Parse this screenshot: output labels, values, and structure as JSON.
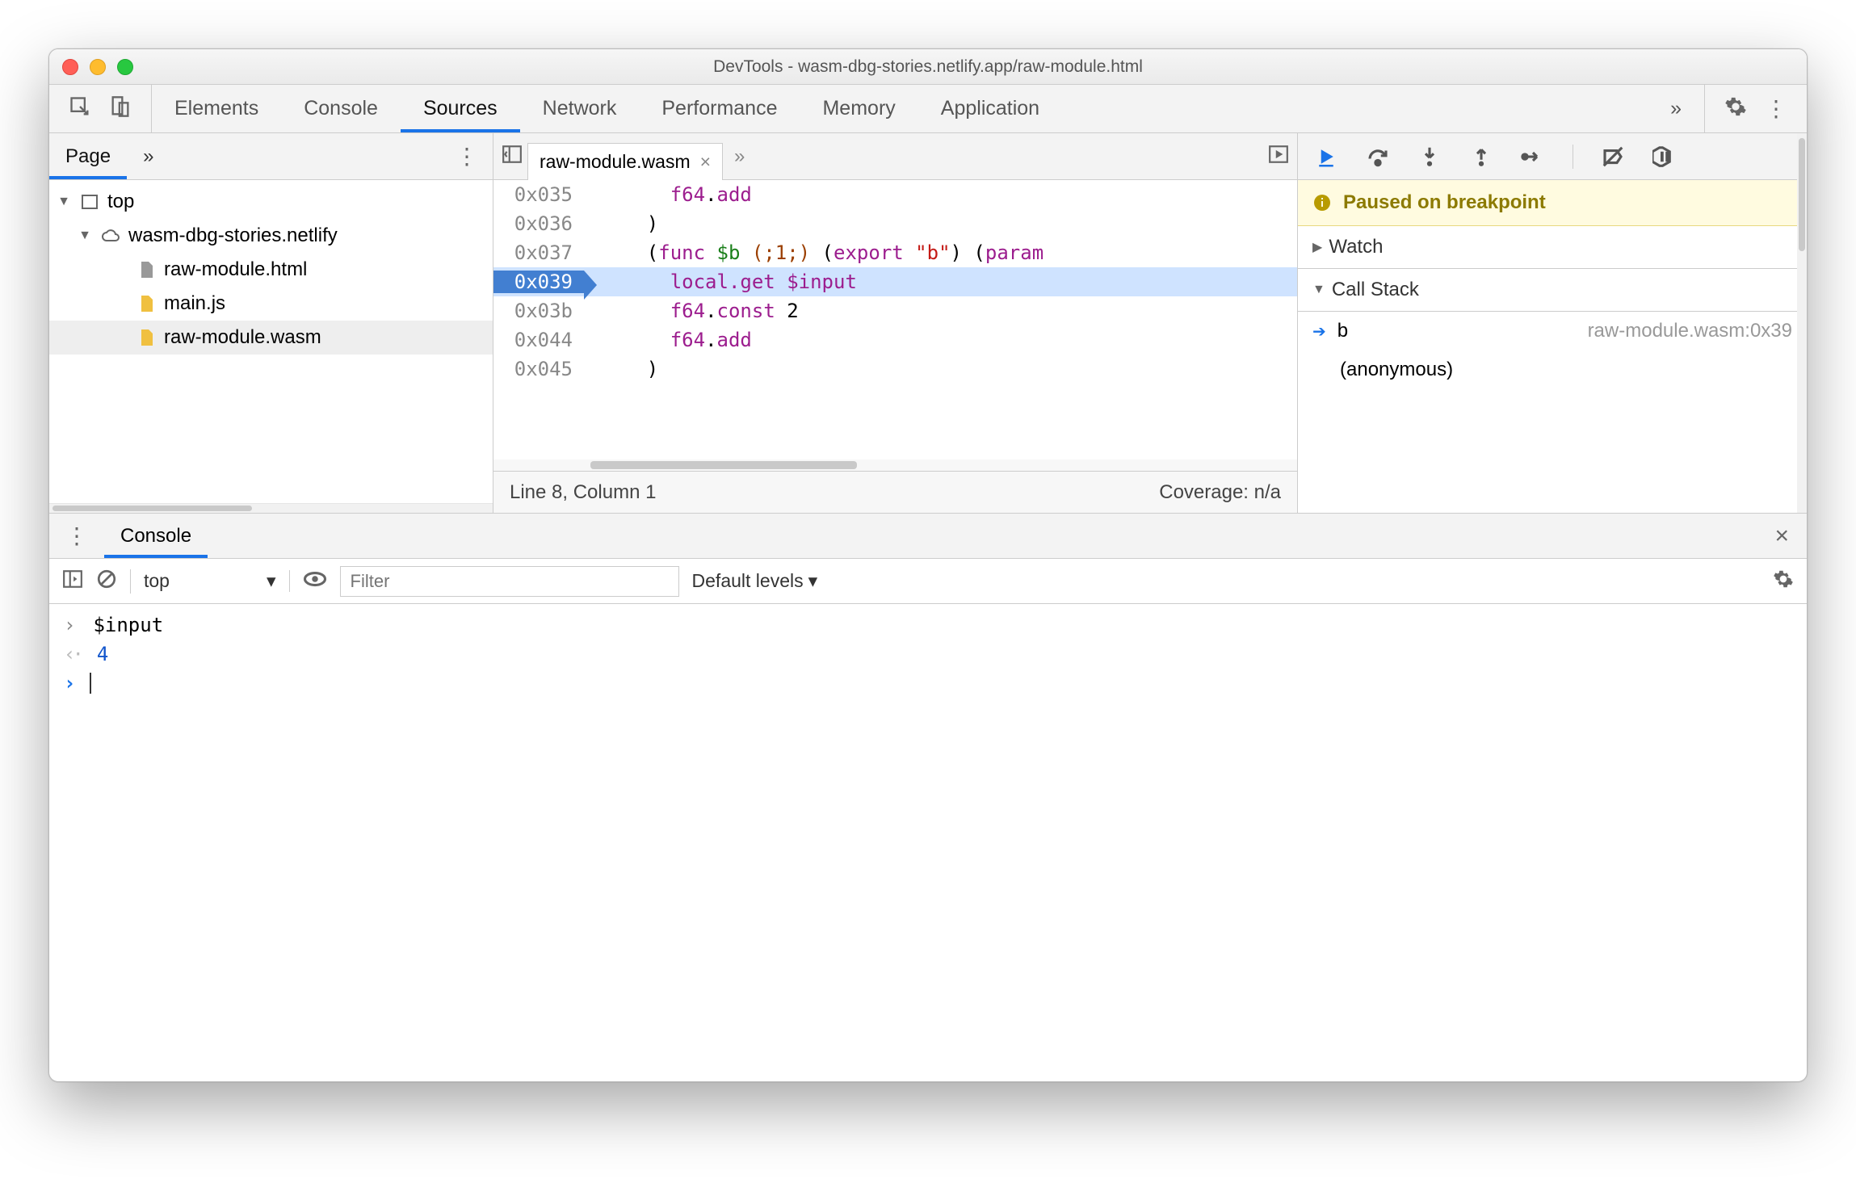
{
  "window": {
    "title": "DevTools - wasm-dbg-stories.netlify.app/raw-module.html"
  },
  "main_tabs": {
    "items": [
      "Elements",
      "Console",
      "Sources",
      "Network",
      "Performance",
      "Memory",
      "Application"
    ],
    "overflow": "»",
    "active": "Sources"
  },
  "sidebar": {
    "subtab": "Page",
    "overflow": "»",
    "tree": {
      "top": "top",
      "origin": "wasm-dbg-stories.netlify",
      "files": [
        "raw-module.html",
        "main.js",
        "raw-module.wasm"
      ],
      "selected": "raw-module.wasm"
    }
  },
  "editor": {
    "filename": "raw-module.wasm",
    "overflow": "»",
    "status": {
      "position": "Line 8, Column 1",
      "coverage": "Coverage: n/a"
    },
    "lines": [
      {
        "addr": "0x035",
        "tokens": [
          {
            "t": "      ",
            "c": ""
          },
          {
            "t": "f64",
            "c": "tk-type"
          },
          {
            "t": ".",
            "c": ""
          },
          {
            "t": "add",
            "c": "tk-kw"
          }
        ]
      },
      {
        "addr": "0x036",
        "tokens": [
          {
            "t": "    )",
            "c": ""
          }
        ]
      },
      {
        "addr": "0x037",
        "tokens": [
          {
            "t": "    (",
            "c": ""
          },
          {
            "t": "func",
            "c": "tk-kw"
          },
          {
            "t": " ",
            "c": ""
          },
          {
            "t": "$b",
            "c": "tk-fn"
          },
          {
            "t": " ",
            "c": ""
          },
          {
            "t": "(;1;)",
            "c": "tk-cmt"
          },
          {
            "t": " (",
            "c": ""
          },
          {
            "t": "export",
            "c": "tk-kw"
          },
          {
            "t": " ",
            "c": ""
          },
          {
            "t": "\"b\"",
            "c": "tk-str"
          },
          {
            "t": ") (",
            "c": ""
          },
          {
            "t": "param",
            "c": "tk-kw"
          }
        ]
      },
      {
        "addr": "0x039",
        "hl": true,
        "tokens": [
          {
            "t": "      ",
            "c": ""
          },
          {
            "t": "local.get",
            "c": "tk-kw"
          },
          {
            "t": " ",
            "c": ""
          },
          {
            "t": "$input",
            "c": "tk-var"
          }
        ]
      },
      {
        "addr": "0x03b",
        "tokens": [
          {
            "t": "      ",
            "c": ""
          },
          {
            "t": "f64",
            "c": "tk-type"
          },
          {
            "t": ".",
            "c": ""
          },
          {
            "t": "const",
            "c": "tk-kw"
          },
          {
            "t": " 2",
            "c": ""
          }
        ]
      },
      {
        "addr": "0x044",
        "tokens": [
          {
            "t": "      ",
            "c": ""
          },
          {
            "t": "f64",
            "c": "tk-type"
          },
          {
            "t": ".",
            "c": ""
          },
          {
            "t": "add",
            "c": "tk-kw"
          }
        ]
      },
      {
        "addr": "0x045",
        "tokens": [
          {
            "t": "    )",
            "c": ""
          }
        ]
      }
    ]
  },
  "debugger": {
    "paused_msg": "Paused on breakpoint",
    "watch_label": "Watch",
    "callstack_label": "Call Stack",
    "frames": [
      {
        "name": "b",
        "loc": "raw-module.wasm:0x39",
        "current": true
      },
      {
        "name": "(anonymous)",
        "loc": "",
        "current": false
      }
    ]
  },
  "drawer": {
    "tab": "Console",
    "context": "top",
    "filter_placeholder": "Filter",
    "levels": "Default levels",
    "entries": [
      {
        "kind": "in",
        "text": "$input"
      },
      {
        "kind": "out",
        "text": "4",
        "num": true
      }
    ]
  },
  "glyphs": {
    "chevrons": "»",
    "triangle_right": "▶",
    "triangle_down": "▼",
    "close": "×",
    "caret_down": "▾"
  }
}
